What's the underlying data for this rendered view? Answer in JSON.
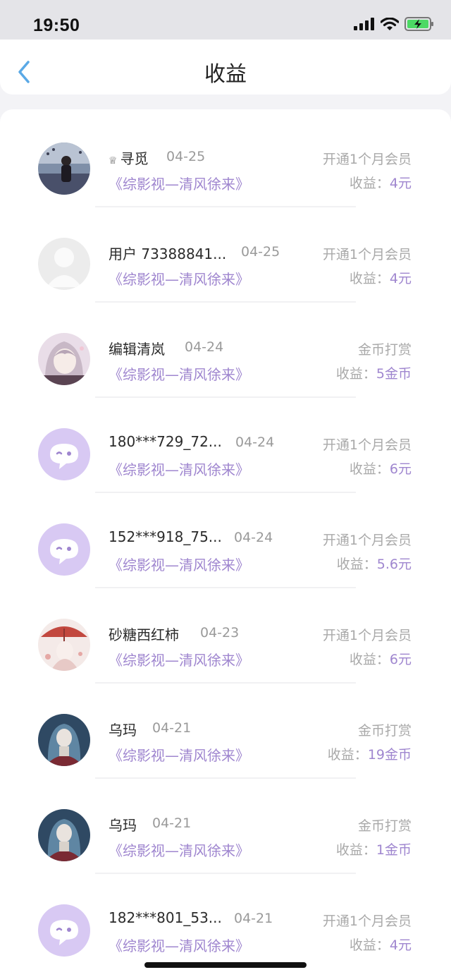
{
  "status": {
    "time": "19:50"
  },
  "header": {
    "title": "收益"
  },
  "colors": {
    "accent": "#9f86cf",
    "chat_avatar_bg": "#d8c9f3"
  },
  "items": [
    {
      "name": "寻觅",
      "crown": true,
      "date": "04-25",
      "book": "《综影视—清风徐来》",
      "type": "开通1个月会员",
      "earn_label": "收益：",
      "earn_value": "4元",
      "avatar": "photo-avatar"
    },
    {
      "name": "用户 73388841...",
      "date": "04-25",
      "book": "《综影视—清风徐来》",
      "type": "开通1个月会员",
      "earn_label": "收益：",
      "earn_value": "4元",
      "avatar": "default-user-avatar"
    },
    {
      "name": "编辑清岚",
      "date": "04-24",
      "book": "《综影视—清风徐来》",
      "type": "金币打赏",
      "earn_label": "收益：",
      "earn_value": "5金币",
      "avatar": "anime-avatar"
    },
    {
      "name": "180***729_72...",
      "date": "04-24",
      "book": "《综影视—清风徐来》",
      "type": "开通1个月会员",
      "earn_label": "收益：",
      "earn_value": "6元",
      "avatar": "chat-bubble-avatar"
    },
    {
      "name": "152***918_75...",
      "date": "04-24",
      "book": "《综影视—清风徐来》",
      "type": "开通1个月会员",
      "earn_label": "收益：",
      "earn_value": "5.6元",
      "avatar": "chat-bubble-avatar"
    },
    {
      "name": "砂糖西红柿",
      "date": "04-23",
      "book": "《综影视—清风徐来》",
      "type": "开通1个月会员",
      "earn_label": "收益：",
      "earn_value": "6元",
      "avatar": "umbrella-avatar"
    },
    {
      "name": "乌玛",
      "date": "04-21",
      "book": "《综影视—清风徐来》",
      "type": "金币打赏",
      "earn_label": "收益：",
      "earn_value": "19金币",
      "avatar": "anime-dark-avatar"
    },
    {
      "name": "乌玛",
      "date": "04-21",
      "book": "《综影视—清风徐来》",
      "type": "金币打赏",
      "earn_label": "收益：",
      "earn_value": "1金币",
      "avatar": "anime-dark-avatar"
    },
    {
      "name": "182***801_53...",
      "date": "04-21",
      "book": "《综影视—清风徐来》",
      "type": "开通1个月会员",
      "earn_label": "收益：",
      "earn_value": "4元",
      "avatar": "chat-bubble-avatar"
    }
  ]
}
